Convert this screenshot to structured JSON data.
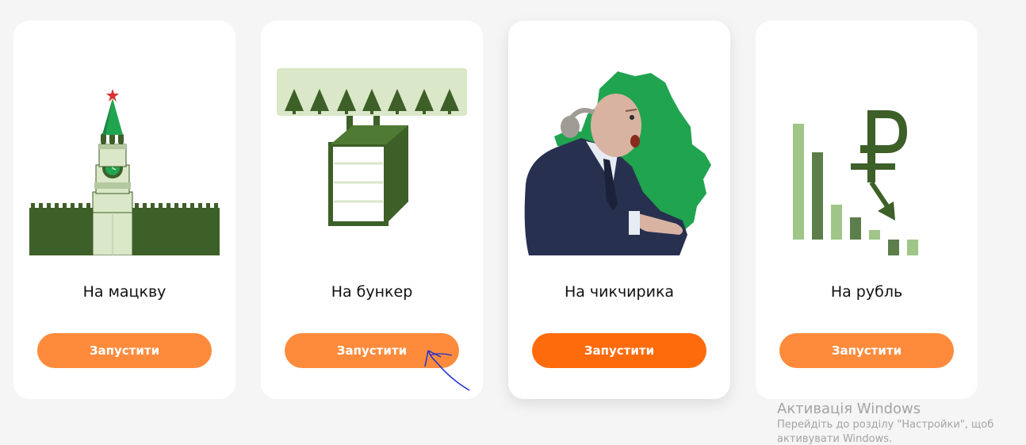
{
  "cards": [
    {
      "title": "На мацкву",
      "button_label": "Запустити",
      "icon": "kremlin-tower-icon"
    },
    {
      "title": "На бункер",
      "button_label": "Запустити",
      "icon": "bunker-icon"
    },
    {
      "title": "На чикчирика",
      "button_label": "Запустити",
      "icon": "politician-icon"
    },
    {
      "title": "На рубль",
      "button_label": "Запустити",
      "icon": "ruble-fall-icon"
    }
  ],
  "watermark": {
    "title": "Активація Windows",
    "text": "Перейдіть до розділу \"Настройки\", щоб активувати Windows."
  },
  "colors": {
    "background": "#f5f5f5",
    "card": "#ffffff",
    "button": "#fe8b3c",
    "button_active": "#fe6b0c",
    "dark_green": "#3d5f28",
    "light_green": "#dae7c8",
    "bright_green": "#20a44f"
  }
}
